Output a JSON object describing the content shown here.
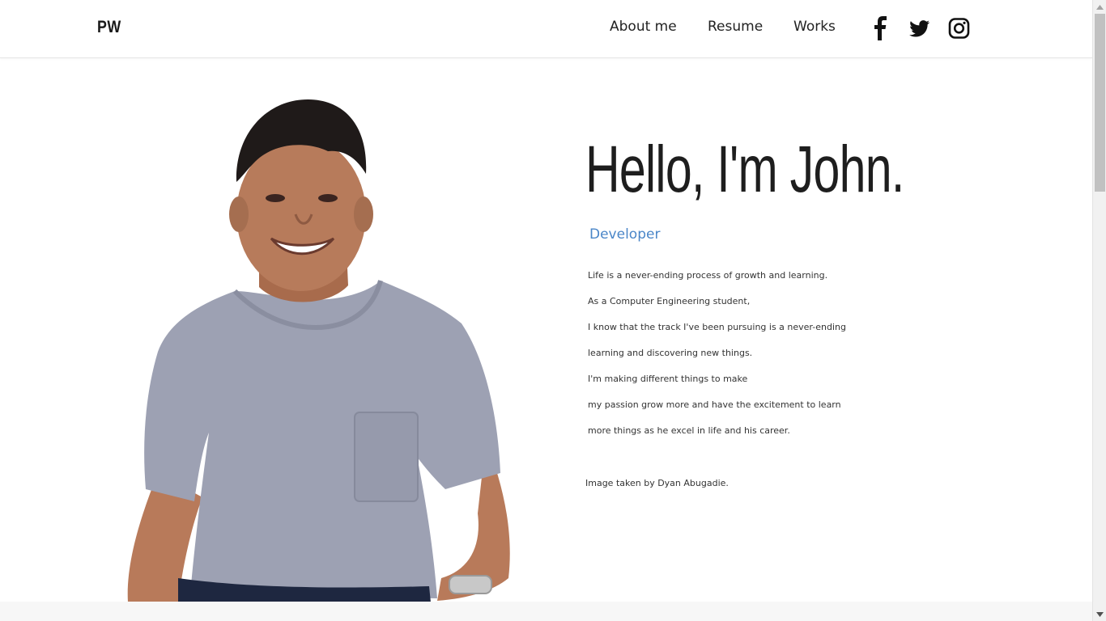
{
  "header": {
    "logo": "PW",
    "nav": [
      {
        "label": "About me"
      },
      {
        "label": "Resume"
      },
      {
        "label": "Works"
      }
    ],
    "social": [
      {
        "icon": "facebook-icon"
      },
      {
        "icon": "twitter-icon"
      },
      {
        "icon": "instagram-icon"
      }
    ]
  },
  "hero": {
    "headline": "Hello, I'm John.",
    "role": "Developer",
    "bio": [
      "Life is a never-ending process of growth and learning.",
      "As a Computer Engineering student,",
      "I know that the track I've been pursuing is a never-ending",
      "learning and discovering new things.",
      "I'm making different things to make",
      "my passion grow more and have the excitement to learn",
      "more things as he excel in life and his career."
    ],
    "credit": "Image taken by Dyan Abugadie."
  },
  "colors": {
    "accent": "#4a86c8",
    "text": "#222222",
    "background": "#ffffff"
  }
}
